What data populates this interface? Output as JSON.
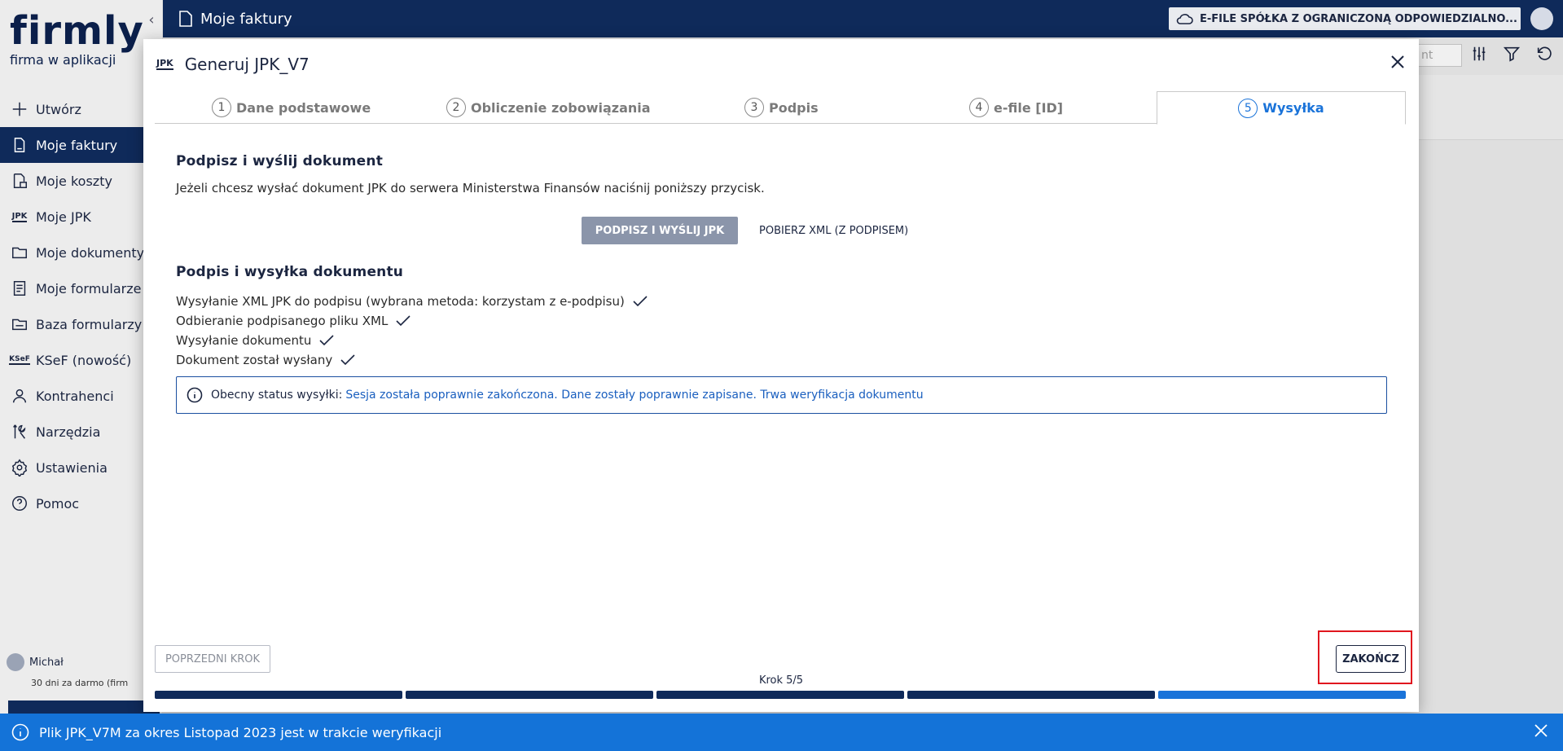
{
  "sidebar": {
    "logo_word": "firmly",
    "logo_sub": "firma w aplikacji",
    "items": [
      {
        "label": "Utwórz",
        "icon": "plus-icon"
      },
      {
        "label": "Moje faktury",
        "icon": "invoice-icon"
      },
      {
        "label": "Moje koszty",
        "icon": "costs-icon"
      },
      {
        "label": "Moje JPK",
        "icon": "jpk-icon",
        "badge": "JPK"
      },
      {
        "label": "Moje dokumenty",
        "icon": "folder-icon"
      },
      {
        "label": "Moje formularze",
        "icon": "form-icon"
      },
      {
        "label": "Baza formularzy",
        "icon": "form-base-icon"
      },
      {
        "label": "KSeF (nowość)",
        "icon": "ksef-icon",
        "badge": "KSeF"
      },
      {
        "label": "Kontrahenci",
        "icon": "person-icon"
      },
      {
        "label": "Narzędzia",
        "icon": "tools-icon"
      },
      {
        "label": "Ustawienia",
        "icon": "gear-icon"
      },
      {
        "label": "Pomoc",
        "icon": "help-icon"
      }
    ],
    "active_index": 1,
    "user_name": "Michał",
    "trial_text": "30 dni za darmo (firm"
  },
  "topbar": {
    "title": "Moje faktury",
    "company": "E-FILE SPÓŁKA Z OGRANICZONĄ ODPOWIEDZIALNO..."
  },
  "background": {
    "search_placeholder": "nt"
  },
  "modal": {
    "badge": "JPK",
    "title": "Generuj JPK_V7",
    "tabs": [
      {
        "num": "1",
        "label": "Dane podstawowe"
      },
      {
        "num": "2",
        "label": "Obliczenie zobowiązania"
      },
      {
        "num": "3",
        "label": "Podpis"
      },
      {
        "num": "4",
        "label": "e-file [ID]"
      },
      {
        "num": "5",
        "label": "Wysyłka"
      }
    ],
    "active_tab": 4,
    "section1_title": "Podpisz i wyślij dokument",
    "section1_text": "Jeżeli chcesz wysłać dokument JPK do serwera Ministerstwa Finansów naciśnij poniższy przycisk.",
    "sign_button": "PODPISZ I WYŚLIJ JPK",
    "xml_button": "POBIERZ XML (Z PODPISEM)",
    "section2_title": "Podpis i wysyłka dokumentu",
    "steps": [
      "Wysyłanie XML JPK do podpisu (wybrana metoda: korzystam z e-podpisu)",
      "Odbieranie podpisanego pliku XML",
      "Wysyłanie dokumentu",
      "Dokument został wysłany"
    ],
    "status_label": "Obecny status wysyłki:",
    "status_value": "Sesja została poprawnie zakończona. Dane zostały poprawnie zapisane. Trwa weryfikacja dokumentu",
    "prev_button": "POPRZEDNI KROK",
    "finish_button": "ZAKOŃCZ",
    "step_counter": "Krok 5/5",
    "progress_total": 5,
    "progress_current": 5
  },
  "notification": {
    "message": "Plik JPK_V7M za okres Listopad 2023 jest w trakcie weryfikacji"
  },
  "colors": {
    "navy": "#0f2a5a",
    "accent": "#1a73d9",
    "notify": "#1473d8",
    "highlight": "#e0161e"
  }
}
